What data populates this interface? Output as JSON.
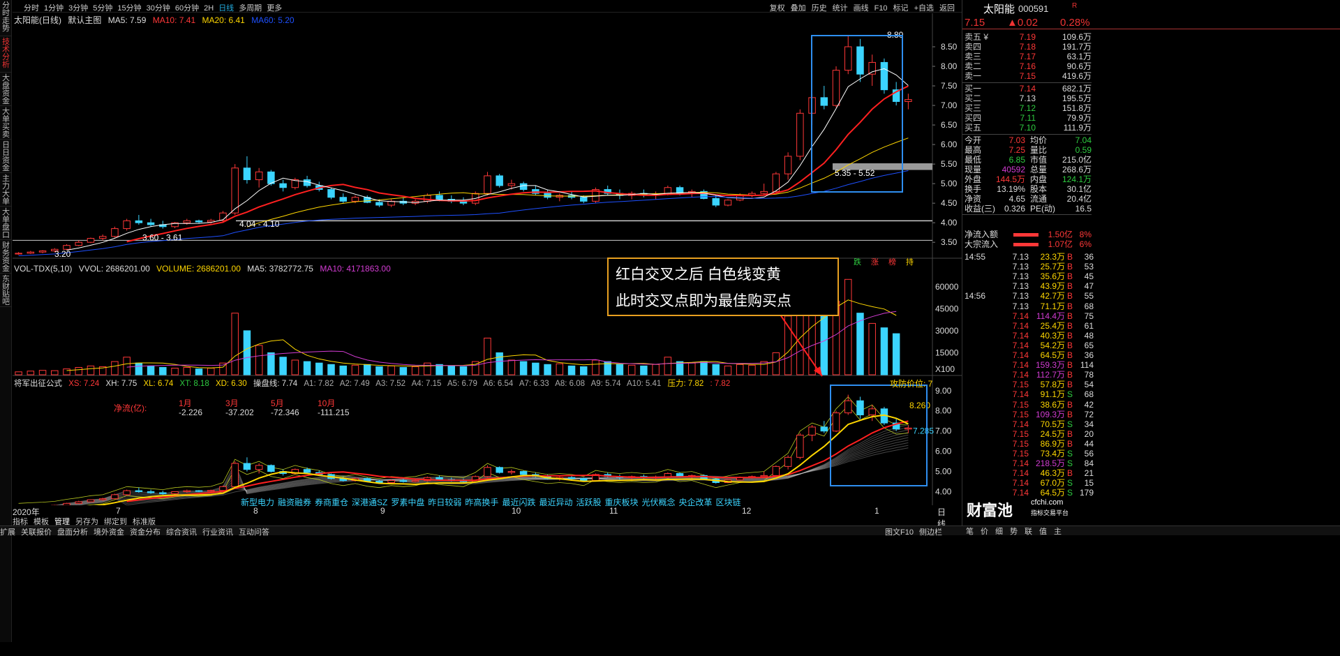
{
  "left_tabs": [
    "分时走势",
    "技术分析",
    "大盘资金",
    "大单买卖",
    "日日资金",
    "主力大单",
    "大单盘口",
    "财务资金",
    "东财贴吧"
  ],
  "left_tabs_active": 1,
  "periods": [
    "分时",
    "1分钟",
    "3分钟",
    "5分钟",
    "15分钟",
    "30分钟",
    "60分钟",
    "2H",
    "日线",
    "多周期",
    "更多"
  ],
  "period_selected": "日线",
  "right_tools": [
    "复权",
    "叠加",
    "历史",
    "统计",
    "画线",
    "F10",
    "标记",
    "+自选",
    "返回"
  ],
  "main_header": {
    "title": "太阳能(日线)",
    "template": "默认主图",
    "ma5": "MA5: 7.59",
    "ma10": "MA10: 7.41",
    "ma20": "MA20: 6.41",
    "ma60": "MA60: 5.20"
  },
  "price_axis": [
    "8.50",
    "8.00",
    "7.50",
    "7.00",
    "6.50",
    "6.00",
    "5.50",
    "5.00",
    "4.50",
    "4.00",
    "3.50"
  ],
  "price_labels": {
    "high": "8.80",
    "support_top": "5.35 - 5.52",
    "support_mid": "4.04 - 4.10",
    "support_low": "3.60 - 3.61",
    "low": "3.20"
  },
  "vol_header": {
    "name": "VOL-TDX(5,10)",
    "vvol": "VVOL: 2686201.00",
    "volume": "VOLUME: 2686201.00",
    "ma5": "MA5: 3782772.75",
    "ma10": "MA10: 4171863.00"
  },
  "vol_axis": [
    "60000",
    "45000",
    "30000",
    "15000",
    "X100"
  ],
  "vol_markers": [
    "跌",
    "涨",
    "榜",
    "持"
  ],
  "ind_header": {
    "name": "将军出征公式",
    "xs": "XS: 7.24",
    "xh": "XH: 7.75",
    "xl": "XL: 6.74",
    "xt": "XT: 8.18",
    "xd": "XD: 6.30",
    "cp": "操盘线: 7.74",
    "a1": "A1: 7.82",
    "a2": "A2: 7.49",
    "a3": "A3: 7.52",
    "a4": "A4: 7.15",
    "a5": "A5: 6.79",
    "a6": "A6: 6.54",
    "a7": "A7: 6.33",
    "a8": "A8: 6.08",
    "a9": "A9: 5.74",
    "a10": "A10: 5.41",
    "pressure": "压力: 7.82",
    "pressure2": ": 7.82",
    "defend": "攻防价位: 7"
  },
  "ind_axis": [
    "9.00",
    "8.00",
    "7.00",
    "6.00",
    "5.00",
    "4.00"
  ],
  "ind_labels": {
    "v1": "8.260",
    "v2": "7.285"
  },
  "net_flow": {
    "label": "净流(亿):",
    "months": [
      "1月",
      "3月",
      "5月",
      "10月"
    ],
    "values": [
      "-2.226",
      "-37.202",
      "-72.346",
      "-111.215"
    ]
  },
  "annotation": [
    "红白交叉之后  白色线变黄",
    "此时交叉点即为最佳购买点"
  ],
  "concepts": [
    "新型电力",
    "融资融券",
    "券商重仓",
    "深港通SZ",
    "罗素中盘",
    "昨日较弱",
    "昨高换手",
    "最近闪跌",
    "最近异动",
    "活跃股",
    "重庆板块",
    "光伏概念",
    "央企改革",
    "区块链"
  ],
  "x_axis": [
    "2020年",
    "7",
    "8",
    "9",
    "10",
    "11",
    "12",
    "1"
  ],
  "period_label": "日线",
  "bottom_tools": [
    "指标",
    "模板",
    "管理",
    "另存为",
    "绑定到",
    "标准版"
  ],
  "status_bar": [
    "扩展",
    "关联报价",
    "盘面分析",
    "境外资金",
    "资金分布",
    "综合资讯",
    "行业资讯",
    "互动问答"
  ],
  "status_right": [
    "图文F10",
    "侧边栏"
  ],
  "stock": {
    "name": "太阳能",
    "code": "000591",
    "r": "R",
    "price": "7.15",
    "change": "▲0.02",
    "pct": "0.28%"
  },
  "sells": [
    [
      "卖五 ¥",
      "7.19",
      "109.6万"
    ],
    [
      "卖四",
      "7.18",
      "191.7万"
    ],
    [
      "卖三",
      "7.17",
      "63.1万"
    ],
    [
      "卖二",
      "7.16",
      "90.6万"
    ],
    [
      "卖一",
      "7.15",
      "419.6万"
    ]
  ],
  "buys": [
    [
      "买一",
      "7.14",
      "682.1万"
    ],
    [
      "买二",
      "7.13",
      "195.5万"
    ],
    [
      "买三",
      "7.12",
      "151.8万"
    ],
    [
      "买四",
      "7.11",
      "79.9万"
    ],
    [
      "买五",
      "7.10",
      "111.9万"
    ]
  ],
  "stats": [
    [
      "今开",
      "7.03",
      "均价",
      "7.04"
    ],
    [
      "最高",
      "7.25",
      "量比",
      "0.59"
    ],
    [
      "最低",
      "6.85",
      "市值",
      "215.0亿"
    ],
    [
      "现量",
      "40592",
      "总量",
      "268.6万"
    ],
    [
      "外盘",
      "144.5万",
      "内盘",
      "124.1万"
    ],
    [
      "换手",
      "13.19%",
      "股本",
      "30.1亿"
    ],
    [
      "净资",
      "4.65",
      "流通",
      "20.4亿"
    ],
    [
      "收益(三)",
      "0.326",
      "PE(动)",
      "16.5"
    ]
  ],
  "flows": [
    [
      "净流入额",
      "1.50亿",
      "8%"
    ],
    [
      "大宗流入",
      "1.07亿",
      "6%"
    ]
  ],
  "trades": [
    [
      "14:55",
      "7.13",
      "23.3万",
      "B",
      "36"
    ],
    [
      "",
      "7.13",
      "25.7万",
      "B",
      "53"
    ],
    [
      "",
      "7.13",
      "35.6万",
      "B",
      "45"
    ],
    [
      "",
      "7.13",
      "43.9万",
      "B",
      "47"
    ],
    [
      "14:56",
      "7.13",
      "42.7万",
      "B",
      "55"
    ],
    [
      "",
      "7.13",
      "71.1万",
      "B",
      "68"
    ],
    [
      "",
      "7.14",
      "114.4万",
      "B",
      "75"
    ],
    [
      "",
      "7.14",
      "25.4万",
      "B",
      "61"
    ],
    [
      "",
      "7.14",
      "40.3万",
      "B",
      "48"
    ],
    [
      "",
      "7.14",
      "54.2万",
      "B",
      "65"
    ],
    [
      "",
      "7.14",
      "64.5万",
      "B",
      "36"
    ],
    [
      "",
      "7.14",
      "159.3万",
      "B",
      "114"
    ],
    [
      "",
      "7.14",
      "112.7万",
      "B",
      "78"
    ],
    [
      "",
      "7.15",
      "57.8万",
      "B",
      "54"
    ],
    [
      "",
      "7.14",
      "91.1万",
      "S",
      "68"
    ],
    [
      "",
      "7.15",
      "38.6万",
      "B",
      "42"
    ],
    [
      "",
      "7.15",
      "109.3万",
      "B",
      "72"
    ],
    [
      "",
      "7.14",
      "70.5万",
      "S",
      "34"
    ],
    [
      "",
      "7.15",
      "24.5万",
      "B",
      "20"
    ],
    [
      "",
      "7.15",
      "86.9万",
      "B",
      "44"
    ],
    [
      "",
      "7.15",
      "73.4万",
      "S",
      "56"
    ],
    [
      "",
      "7.14",
      "218.5万",
      "S",
      "84"
    ],
    [
      "",
      "7.14",
      "46.3万",
      "B",
      "21"
    ],
    [
      "",
      "7.14",
      "67.0万",
      "S",
      "15"
    ],
    [
      "",
      "7.14",
      "64.5万",
      "S",
      "179"
    ]
  ],
  "brand": {
    "text": "财富池",
    "site": "cfchi.com",
    "sub": "指标交易平台"
  },
  "right_tabs": [
    "笔",
    "价",
    "细",
    "势",
    "联",
    "值",
    "主"
  ],
  "colors": {
    "up": "#ff3838",
    "down": "#3bd4ff",
    "ma5": "#ffffff",
    "ma10": "#ff2020",
    "ma20": "#ffd700",
    "ma60": "#1e50ff",
    "box": "#2f8ff0",
    "annot_border": "#e8a020"
  },
  "chart_data": {
    "type": "candlestick",
    "price_ylim": [
      3.2,
      9.0
    ],
    "candles": [
      [
        3.2,
        3.25,
        3.18,
        3.22
      ],
      [
        3.22,
        3.28,
        3.2,
        3.25
      ],
      [
        3.25,
        3.3,
        3.22,
        3.28
      ],
      [
        3.28,
        3.35,
        3.25,
        3.32
      ],
      [
        3.32,
        3.45,
        3.3,
        3.42
      ],
      [
        3.42,
        3.55,
        3.4,
        3.5
      ],
      [
        3.5,
        3.62,
        3.48,
        3.6
      ],
      [
        3.6,
        3.7,
        3.55,
        3.65
      ],
      [
        3.65,
        3.9,
        3.62,
        3.85
      ],
      [
        3.85,
        4.1,
        3.8,
        4.05
      ],
      [
        4.05,
        4.2,
        3.95,
        4.0
      ],
      [
        4.0,
        4.1,
        3.9,
        3.95
      ],
      [
        3.95,
        4.05,
        3.85,
        3.9
      ],
      [
        3.9,
        4.02,
        3.86,
        4.0
      ],
      [
        4.0,
        4.1,
        3.95,
        4.05
      ],
      [
        4.05,
        4.08,
        3.98,
        4.02
      ],
      [
        4.02,
        4.1,
        3.98,
        4.06
      ],
      [
        4.06,
        4.3,
        4.0,
        4.25
      ],
      [
        4.25,
        5.5,
        4.2,
        5.4
      ],
      [
        5.4,
        5.7,
        5.0,
        5.1
      ],
      [
        5.1,
        5.4,
        4.9,
        5.3
      ],
      [
        5.3,
        5.35,
        4.95,
        5.0
      ],
      [
        5.0,
        5.1,
        4.8,
        4.9
      ],
      [
        4.9,
        5.15,
        4.85,
        5.1
      ],
      [
        5.1,
        5.2,
        4.9,
        4.95
      ],
      [
        4.95,
        5.05,
        4.8,
        4.85
      ],
      [
        4.85,
        4.9,
        4.6,
        4.65
      ],
      [
        4.65,
        4.75,
        4.5,
        4.55
      ],
      [
        4.55,
        4.7,
        4.5,
        4.65
      ],
      [
        4.65,
        4.7,
        4.5,
        4.52
      ],
      [
        4.52,
        4.6,
        4.4,
        4.45
      ],
      [
        4.45,
        4.6,
        4.4,
        4.55
      ],
      [
        4.55,
        4.65,
        4.45,
        4.5
      ],
      [
        4.5,
        4.6,
        4.45,
        4.55
      ],
      [
        4.55,
        4.75,
        4.5,
        4.7
      ],
      [
        4.7,
        4.8,
        4.55,
        4.6
      ],
      [
        4.6,
        4.7,
        4.5,
        4.55
      ],
      [
        4.55,
        4.65,
        4.45,
        4.5
      ],
      [
        4.5,
        4.8,
        4.45,
        4.75
      ],
      [
        4.75,
        5.3,
        4.7,
        5.2
      ],
      [
        5.2,
        5.25,
        4.9,
        4.95
      ],
      [
        4.95,
        5.1,
        4.85,
        5.0
      ],
      [
        5.0,
        5.05,
        4.8,
        4.85
      ],
      [
        4.85,
        4.95,
        4.7,
        4.75
      ],
      [
        4.75,
        4.85,
        4.6,
        4.65
      ],
      [
        4.65,
        4.75,
        4.55,
        4.7
      ],
      [
        4.7,
        4.8,
        4.6,
        4.65
      ],
      [
        4.65,
        4.7,
        4.5,
        4.55
      ],
      [
        4.55,
        4.9,
        4.5,
        4.85
      ],
      [
        4.85,
        4.95,
        4.7,
        4.75
      ],
      [
        4.75,
        4.85,
        4.6,
        4.7
      ],
      [
        4.7,
        4.8,
        4.6,
        4.75
      ],
      [
        4.75,
        4.85,
        4.65,
        4.7
      ],
      [
        4.7,
        4.8,
        4.6,
        4.72
      ],
      [
        4.72,
        4.95,
        4.7,
        4.9
      ],
      [
        4.9,
        4.95,
        4.7,
        4.75
      ],
      [
        4.75,
        4.85,
        4.65,
        4.8
      ],
      [
        4.8,
        4.85,
        4.6,
        4.62
      ],
      [
        4.62,
        4.7,
        4.4,
        4.45
      ],
      [
        4.45,
        4.6,
        4.42,
        4.58
      ],
      [
        4.58,
        4.75,
        4.55,
        4.7
      ],
      [
        4.7,
        4.8,
        4.65,
        4.75
      ],
      [
        4.75,
        5.0,
        4.7,
        4.8
      ],
      [
        4.8,
        5.3,
        4.75,
        5.25
      ],
      [
        5.25,
        5.8,
        5.1,
        5.7
      ],
      [
        5.7,
        6.9,
        5.6,
        6.8
      ],
      [
        6.8,
        7.3,
        6.5,
        7.2
      ],
      [
        7.2,
        7.5,
        6.9,
        7.0
      ],
      [
        7.0,
        8.0,
        6.95,
        7.9
      ],
      [
        7.9,
        8.8,
        7.8,
        8.5
      ],
      [
        8.5,
        8.7,
        7.6,
        7.8
      ],
      [
        7.8,
        8.3,
        7.5,
        8.1
      ],
      [
        8.1,
        8.2,
        7.3,
        7.4
      ],
      [
        7.4,
        7.6,
        7.0,
        7.1
      ],
      [
        7.1,
        7.3,
        6.9,
        7.15
      ]
    ],
    "volume_ylim": [
      0,
      68000
    ],
    "volume": [
      2000,
      2500,
      3000,
      2800,
      4000,
      5000,
      6000,
      5500,
      9000,
      12000,
      8000,
      6000,
      5000,
      4500,
      5000,
      4000,
      4500,
      8000,
      42000,
      30000,
      20000,
      15000,
      12000,
      10000,
      9000,
      8000,
      7000,
      6000,
      6500,
      7000,
      5500,
      6000,
      5000,
      5500,
      8000,
      7000,
      6000,
      5500,
      9000,
      25000,
      15000,
      10000,
      9000,
      8000,
      7000,
      7500,
      6000,
      5500,
      10000,
      9000,
      7000,
      6500,
      6000,
      7000,
      12000,
      9000,
      8000,
      9000,
      7000,
      6000,
      7000,
      6500,
      9000,
      15000,
      40000,
      55000,
      45000,
      40000,
      50000,
      65000,
      42000,
      35000,
      32000,
      28000
    ]
  }
}
